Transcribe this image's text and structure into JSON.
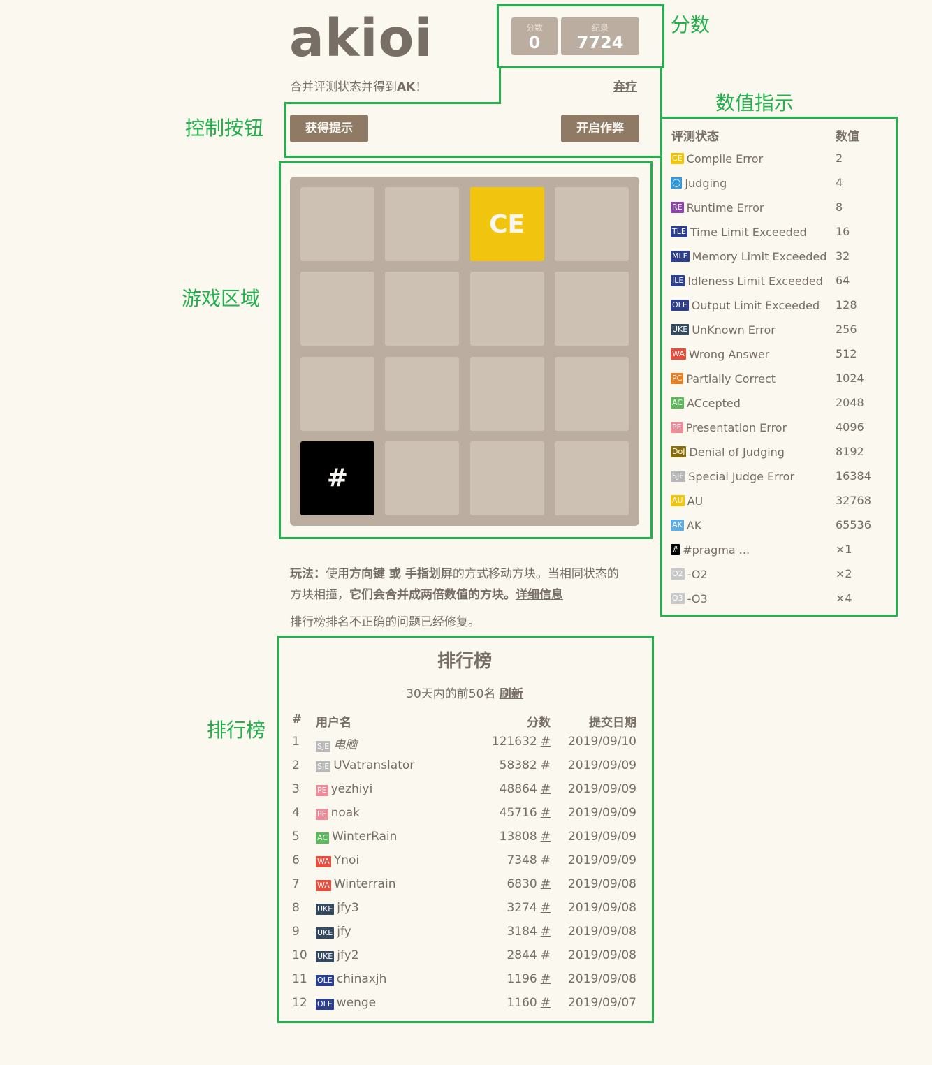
{
  "header": {
    "title": "akioi",
    "score_label": "分数",
    "score_value": "0",
    "best_label": "纪录",
    "best_value": "7724",
    "subtitle_pre": "合并评测状态并得到",
    "subtitle_bold": "AK",
    "subtitle_post": "！",
    "giveup": "弃疗"
  },
  "controls": {
    "hint_button": "获得提示",
    "cheat_button": "开启作弊"
  },
  "board": {
    "tiles": [
      {
        "row": 0,
        "col": 2,
        "text": "CE",
        "color": "#f1c40f"
      },
      {
        "row": 3,
        "col": 0,
        "text": "#",
        "color": "#000000"
      }
    ]
  },
  "instructions": {
    "p1_a": "玩法：",
    "p1_b": "使用",
    "p1_c": "方向键 或 手指划屏",
    "p1_d": "的方式移动方块。当相同状态的",
    "p2_a": "方块相撞，",
    "p2_b": "它们会合并成两倍数值的方块。",
    "p2_link": "详细信息",
    "p3": "排行榜排名不正确的问题已经修复。"
  },
  "legend": {
    "col_status": "评测状态",
    "col_value": "数值",
    "rows": [
      {
        "badge": "CE",
        "badge_color": "#f1c40f",
        "name": "Compile Error",
        "value": "2"
      },
      {
        "badge": "◯",
        "badge_color": "#3498db",
        "name": "Judging",
        "value": "4"
      },
      {
        "badge": "RE",
        "badge_color": "#8e44ad",
        "name": "Runtime Error",
        "value": "8"
      },
      {
        "badge": "TLE",
        "badge_color": "#2c3e8f",
        "name": "Time Limit Exceeded",
        "value": "16"
      },
      {
        "badge": "MLE",
        "badge_color": "#2c3e8f",
        "name": "Memory Limit Exceeded",
        "value": "32"
      },
      {
        "badge": "ILE",
        "badge_color": "#2c3e8f",
        "name": "Idleness Limit Exceeded",
        "value": "64"
      },
      {
        "badge": "OLE",
        "badge_color": "#2c3e8f",
        "name": "Output Limit Exceeded",
        "value": "128"
      },
      {
        "badge": "UKE",
        "badge_color": "#34495e",
        "name": "UnKnown Error",
        "value": "256"
      },
      {
        "badge": "WA",
        "badge_color": "#e74c3c",
        "name": "Wrong Answer",
        "value": "512"
      },
      {
        "badge": "PC",
        "badge_color": "#e67e22",
        "name": "Partially Correct",
        "value": "1024"
      },
      {
        "badge": "AC",
        "badge_color": "#5cb85c",
        "name": "ACcepted",
        "value": "2048"
      },
      {
        "badge": "PE",
        "badge_color": "#f08c9a",
        "name": "Presentation Error",
        "value": "4096"
      },
      {
        "badge": "DoJ",
        "badge_color": "#8a6d0b",
        "name": "Denial of Judging",
        "value": "8192"
      },
      {
        "badge": "SJE",
        "badge_color": "#b8b8b8",
        "name": "Special Judge Error",
        "value": "16384"
      },
      {
        "badge": "AU",
        "badge_color": "#f1c40f",
        "name": "AU",
        "value": "32768"
      },
      {
        "badge": "AK",
        "badge_color": "#5dade2",
        "name": "AK",
        "value": "65536"
      },
      {
        "badge": "#",
        "badge_color": "#000000",
        "name": "#pragma ...",
        "value": "×1"
      },
      {
        "badge": "O2",
        "badge_color": "#c8c8c8",
        "name": "-O2",
        "value": "×2"
      },
      {
        "badge": "O3",
        "badge_color": "#c8c8c8",
        "name": "-O3",
        "value": "×4"
      }
    ]
  },
  "ranking": {
    "title": "排行榜",
    "subtitle": "30天内的前50名",
    "refresh": "刷新",
    "headers": {
      "rank": "#",
      "user": "用户名",
      "score": "分数",
      "date": "提交日期"
    },
    "rows": [
      {
        "rank": "1",
        "badge": "SJE",
        "badge_color": "#b8b8b8",
        "user": "电脑",
        "score": "121632",
        "date": "2019/09/10"
      },
      {
        "rank": "2",
        "badge": "SJE",
        "badge_color": "#b8b8b8",
        "user": "UVatranslator",
        "score": "58382",
        "date": "2019/09/09"
      },
      {
        "rank": "3",
        "badge": "PE",
        "badge_color": "#f08c9a",
        "user": "yezhiyi",
        "score": "48864",
        "date": "2019/09/09"
      },
      {
        "rank": "4",
        "badge": "PE",
        "badge_color": "#f08c9a",
        "user": "noak",
        "score": "45716",
        "date": "2019/09/09"
      },
      {
        "rank": "5",
        "badge": "AC",
        "badge_color": "#5cb85c",
        "user": "WinterRain",
        "score": "13808",
        "date": "2019/09/09"
      },
      {
        "rank": "6",
        "badge": "WA",
        "badge_color": "#e74c3c",
        "user": "Ynoi",
        "score": "7348",
        "date": "2019/09/09"
      },
      {
        "rank": "7",
        "badge": "WA",
        "badge_color": "#e74c3c",
        "user": "Winterrain",
        "score": "6830",
        "date": "2019/09/08"
      },
      {
        "rank": "8",
        "badge": "UKE",
        "badge_color": "#34495e",
        "user": "jfy3",
        "score": "3274",
        "date": "2019/09/08"
      },
      {
        "rank": "9",
        "badge": "UKE",
        "badge_color": "#34495e",
        "user": "jfy",
        "score": "3184",
        "date": "2019/09/08"
      },
      {
        "rank": "10",
        "badge": "UKE",
        "badge_color": "#34495e",
        "user": "jfy2",
        "score": "2844",
        "date": "2019/09/08"
      },
      {
        "rank": "11",
        "badge": "OLE",
        "badge_color": "#2c3e8f",
        "user": "chinaxjh",
        "score": "1196",
        "date": "2019/09/08"
      },
      {
        "rank": "12",
        "badge": "OLE",
        "badge_color": "#2c3e8f",
        "user": "wenge",
        "score": "1160",
        "date": "2019/09/07"
      }
    ],
    "row_link": "#"
  },
  "annotations": {
    "score": "分数",
    "controls": "控制按钮",
    "game_area": "游戏区域",
    "values": "数值指示",
    "ranking": "排行榜"
  },
  "annotation_color": "#22b14c"
}
